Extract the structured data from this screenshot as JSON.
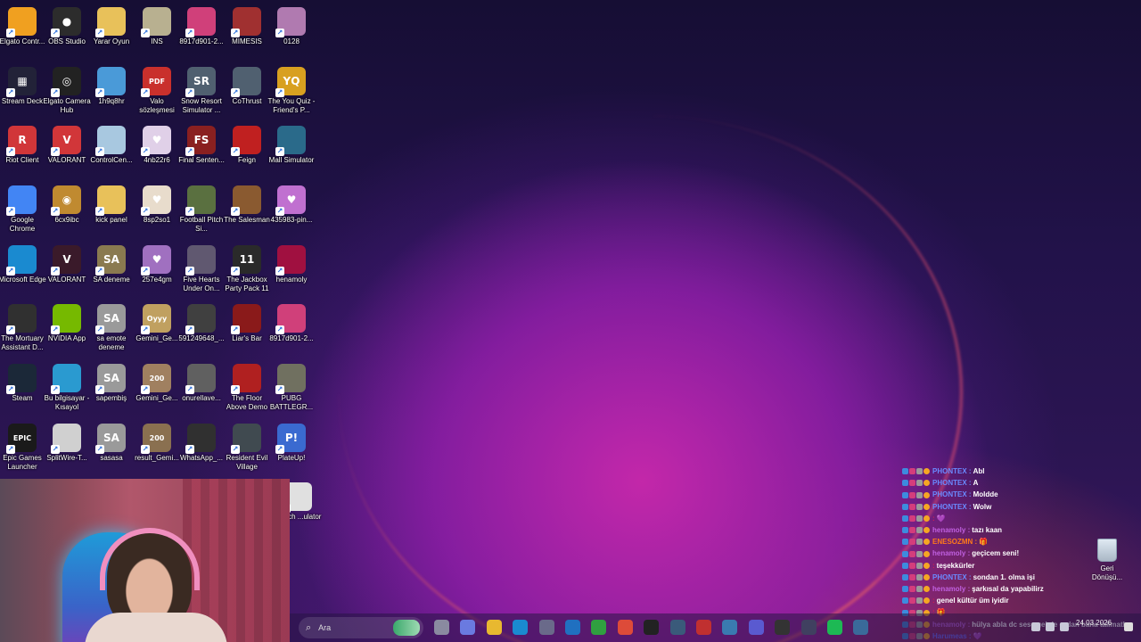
{
  "desktop": {
    "icons": [
      {
        "label": "Elgato Contr...",
        "glyph": "",
        "color": "#f0a020"
      },
      {
        "label": "OBS Studio",
        "glyph": "●",
        "color": "#2c2c2c"
      },
      {
        "label": "Yarar Oyun",
        "glyph": "",
        "color": "#e8c15a"
      },
      {
        "label": "INS",
        "glyph": "",
        "color": "#b8b090"
      },
      {
        "label": "8917d901-2...",
        "glyph": "",
        "color": "#d0407a"
      },
      {
        "label": "MIMESIS",
        "glyph": "",
        "color": "#a03030"
      },
      {
        "label": "0128",
        "glyph": "",
        "color": "#b07ab0"
      },
      {
        "label": "Stream Deck",
        "glyph": "▦",
        "color": "#222238"
      },
      {
        "label": "Elgato Camera Hub",
        "glyph": "◎",
        "color": "#222"
      },
      {
        "label": "1h9q8hr",
        "glyph": "",
        "color": "#4a9ad8"
      },
      {
        "label": "Valo sözleşmesi",
        "glyph": "PDF",
        "color": "#c9302c"
      },
      {
        "label": "Snow Resort Simulator ...",
        "glyph": "SR",
        "color": "#506070"
      },
      {
        "label": "CoThrust",
        "glyph": "",
        "color": "#506070"
      },
      {
        "label": "The You Quiz - Friend's P...",
        "glyph": "YQ",
        "color": "#d8a020"
      },
      {
        "label": "Riot Client",
        "glyph": "R",
        "color": "#d13639"
      },
      {
        "label": "VALORANT",
        "glyph": "V",
        "color": "#d13639"
      },
      {
        "label": "ControlCen...",
        "glyph": "",
        "color": "#a8c8e0"
      },
      {
        "label": "4nb22r6",
        "glyph": "♥",
        "color": "#e0d0e8"
      },
      {
        "label": "Final Senten...",
        "glyph": "FS",
        "color": "#8a2020"
      },
      {
        "label": "Feign",
        "glyph": "",
        "color": "#c02020"
      },
      {
        "label": "Mall Simulator",
        "glyph": "",
        "color": "#2a6a8a"
      },
      {
        "label": "Google Chrome",
        "glyph": "",
        "color": "#4285f4"
      },
      {
        "label": "6cx9ibc",
        "glyph": "◉",
        "color": "#c08a30"
      },
      {
        "label": "kick panel",
        "glyph": "",
        "color": "#e8c15a"
      },
      {
        "label": "8sp2so1",
        "glyph": "♥",
        "color": "#e8dccc"
      },
      {
        "label": "Football Pitch Si...",
        "glyph": "",
        "color": "#5a7040"
      },
      {
        "label": "The Salesman",
        "glyph": "",
        "color": "#8a5a30"
      },
      {
        "label": "435983-pin...",
        "glyph": "♥",
        "color": "#c070d0"
      },
      {
        "label": "Microsoft Edge",
        "glyph": "",
        "color": "#1a8ad0"
      },
      {
        "label": "VALORANT",
        "glyph": "V",
        "color": "#3a1a2a"
      },
      {
        "label": "SA deneme",
        "glyph": "SA",
        "color": "#8a7a50"
      },
      {
        "label": "257e4gm",
        "glyph": "♥",
        "color": "#a070c0"
      },
      {
        "label": "Five Hearts Under On...",
        "glyph": "",
        "color": "#605870"
      },
      {
        "label": "The Jackbox Party Pack 11",
        "glyph": "11",
        "color": "#2a2a2a"
      },
      {
        "label": "henamoly",
        "glyph": "",
        "color": "#a01040"
      },
      {
        "label": "The Mortuary Assistant D...",
        "glyph": "",
        "color": "#303030"
      },
      {
        "label": "NVIDIA App",
        "glyph": "",
        "color": "#76b900"
      },
      {
        "label": "sa emote deneme",
        "glyph": "SA",
        "color": "#9a9a9a"
      },
      {
        "label": "Gemini_Ge...",
        "glyph": "Oyyy",
        "color": "#c0a060"
      },
      {
        "label": "591249648_...",
        "glyph": "",
        "color": "#404040"
      },
      {
        "label": "Liar's Bar",
        "glyph": "",
        "color": "#8a1a1a"
      },
      {
        "label": "8917d901-2...",
        "glyph": "",
        "color": "#d0407a"
      },
      {
        "label": "Steam",
        "glyph": "",
        "color": "#1b2838"
      },
      {
        "label": "Bu bilgisayar - Kısayol",
        "glyph": "",
        "color": "#2a9ad0"
      },
      {
        "label": "sapembiş",
        "glyph": "SA",
        "color": "#9a9a9a"
      },
      {
        "label": "Gemini_Ge...",
        "glyph": "200",
        "color": "#a08060"
      },
      {
        "label": "onurellave...",
        "glyph": "",
        "color": "#606060"
      },
      {
        "label": "The Floor Above Demo",
        "glyph": "",
        "color": "#b02020"
      },
      {
        "label": "PUBG BATTLEGR...",
        "glyph": "",
        "color": "#707060"
      },
      {
        "label": "Epic Games Launcher",
        "glyph": "EPIC",
        "color": "#1a1a1a"
      },
      {
        "label": "SplitWire-T...",
        "glyph": "",
        "color": "#d0d0d0"
      },
      {
        "label": "sasasa",
        "glyph": "SA",
        "color": "#9a9a9a"
      },
      {
        "label": "result_Gemi...",
        "glyph": "200",
        "color": "#8a7050"
      },
      {
        "label": "WhatsApp_...",
        "glyph": "",
        "color": "#303030"
      },
      {
        "label": "Resident Evil Village",
        "glyph": "",
        "color": "#404a50"
      },
      {
        "label": "PlateUp!",
        "glyph": "P!",
        "color": "#3a6ad0"
      },
      {
        "label": "...anch ...ulator",
        "glyph": "",
        "color": "#e0e0e0"
      }
    ]
  },
  "chat": {
    "lines": [
      {
        "user": "PHONTEX",
        "color": "#6a8aff",
        "msg": "Abl"
      },
      {
        "user": "PHONTEX",
        "color": "#6a8aff",
        "msg": "A"
      },
      {
        "user": "PHONTEX",
        "color": "#6a8aff",
        "msg": "Moldde"
      },
      {
        "user": "PHONTEX",
        "color": "#6a8aff",
        "msg": "Wolw"
      },
      {
        "user": "",
        "color": "#d02050",
        "msg": "💜"
      },
      {
        "user": "henamoly",
        "color": "#c060e0",
        "msg": "tazı kaan"
      },
      {
        "user": "ENESOZMN",
        "color": "#ff7a1a",
        "msg": "🎁"
      },
      {
        "user": "henamoly",
        "color": "#c060e0",
        "msg": "geçicem seni!"
      },
      {
        "user": "",
        "color": "#d02050",
        "msg": "teşekkürler"
      },
      {
        "user": "PHONTEX",
        "color": "#6a8aff",
        "msg": "sondan 1. olma işi"
      },
      {
        "user": "henamoly",
        "color": "#c060e0",
        "msg": "şarkısal da yapabilirz"
      },
      {
        "user": "",
        "color": "#d02050",
        "msg": "genel kültür üm iyidir"
      },
      {
        "user": "",
        "color": "#d02050",
        "msg": "🎁"
      },
      {
        "user": "henamoly",
        "color": "#c060e0",
        "msg": "hülya abla dc sese gel de ordan bana talimatları ver"
      },
      {
        "user": "Harumeas",
        "color": "#6a6aff",
        "msg": "💜"
      }
    ]
  },
  "recycle_bin": {
    "label": "Geri Dönüşü..."
  },
  "taskbar": {
    "search_placeholder": "Ara",
    "apps": [
      {
        "name": "task-view",
        "color": "#8a8aa0"
      },
      {
        "name": "copilot",
        "color": "#6a7ae0"
      },
      {
        "name": "file-explorer",
        "color": "#e8b830"
      },
      {
        "name": "edge",
        "color": "#1a8ad0"
      },
      {
        "name": "store",
        "color": "#6a6a8a"
      },
      {
        "name": "outlook",
        "color": "#2070c0"
      },
      {
        "name": "xbox",
        "color": "#30a040"
      },
      {
        "name": "chrome",
        "color": "#dd4b39"
      },
      {
        "name": "epic",
        "color": "#222"
      },
      {
        "name": "steam",
        "color": "#3a5a7a"
      },
      {
        "name": "app-red",
        "color": "#c03030"
      },
      {
        "name": "app-blue",
        "color": "#3a7ab0"
      },
      {
        "name": "app-purple",
        "color": "#5a5ad0"
      },
      {
        "name": "obs",
        "color": "#333"
      },
      {
        "name": "app-grey",
        "color": "#404060"
      },
      {
        "name": "spotify",
        "color": "#1db954"
      },
      {
        "name": "steam-2",
        "color": "#3a6a9a"
      }
    ],
    "clock_time": "",
    "clock_date": "24.03.2026"
  }
}
